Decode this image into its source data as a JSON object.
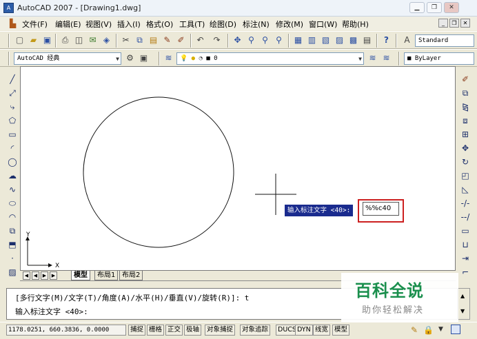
{
  "window": {
    "title": "AutoCAD 2007 - [Drawing1.dwg]",
    "app_icon": "autocad-logo-icon",
    "controls": [
      "minimize",
      "restore",
      "close"
    ]
  },
  "menu": {
    "items": [
      "文件(F)",
      "编辑(E)",
      "视图(V)",
      "插入(I)",
      "格式(O)",
      "工具(T)",
      "绘图(D)",
      "标注(N)",
      "修改(M)",
      "窗口(W)",
      "帮助(H)"
    ]
  },
  "toolbar2": {
    "workspace_value": "AutoCAD 经典",
    "layer_value": "0",
    "color_value": "ByLayer",
    "style_value": "Standard"
  },
  "layout_tabs": [
    "模型",
    "布局1",
    "布局2"
  ],
  "ucs": {
    "x_label": "X",
    "y_label": "Y"
  },
  "dynamic_input": {
    "prompt": "输入标注文字 <40>:",
    "value": "%%c40"
  },
  "command_line": {
    "line1": "[多行文字(M)/文字(T)/角度(A)/水平(H)/垂直(V)/旋转(R)]: t",
    "line2": "输入标注文字 <40>:"
  },
  "status": {
    "coordinates": "1178.0251, 660.3836, 0.0000",
    "toggles": [
      "捕捉",
      "栅格",
      "正交",
      "极轴",
      "对象捕捉",
      "对象追踪",
      "DUCS",
      "DYN",
      "线宽",
      "模型"
    ]
  },
  "watermark": {
    "line1": "百科全说",
    "line2": "助你轻松解决"
  },
  "colors": {
    "dyn_label_bg": "#1a2b8e",
    "highlight_border": "#cc1f1f",
    "watermark_green": "#1a8f4d"
  }
}
